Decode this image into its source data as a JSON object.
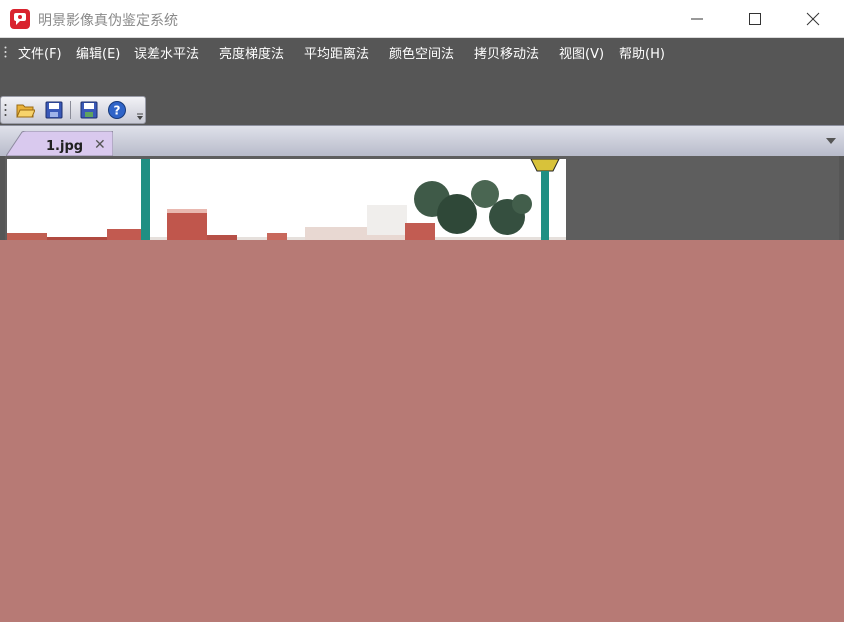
{
  "window": {
    "title": "明景影像真伪鉴定系统",
    "minimize_icon": "minimize-icon",
    "maximize_icon": "maximize-icon",
    "close_icon": "close-icon"
  },
  "menu": {
    "items": [
      "文件(F)",
      "编辑(E)",
      "误差水平法",
      "亮度梯度法",
      "平均距离法",
      "颜色空间法",
      "拷贝移动法",
      "视图(V)",
      "帮助(H)"
    ]
  },
  "toolbar": {
    "buttons": [
      "open-folder-icon",
      "save-icon",
      "save-as-icon",
      "help-icon"
    ]
  },
  "tabs": [
    {
      "label": "1.jpg",
      "close_icon": "close-icon"
    }
  ],
  "colors": {
    "menubar_bg": "#565656",
    "workspace_bg": "#5e5e5e",
    "overlay": "#b77a75",
    "app_icon": "#d9232e"
  }
}
